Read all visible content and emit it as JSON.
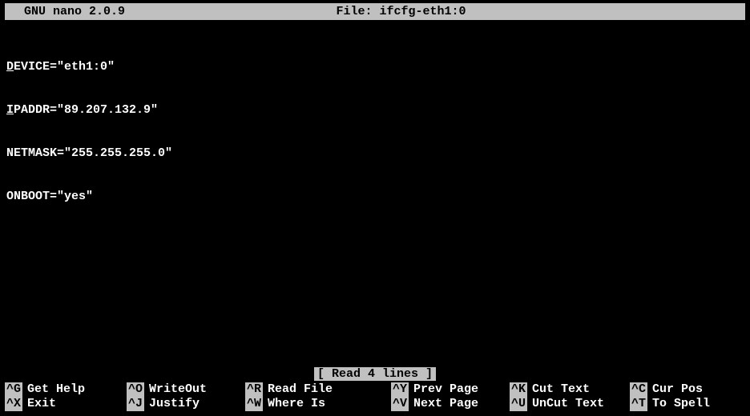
{
  "titlebar": {
    "app": "  GNU nano 2.0.9",
    "file": "File: ifcfg-eth1:0"
  },
  "content": {
    "lines": [
      "DEVICE=\"eth1:0\"",
      "IPADDR=\"89.207.132.9\"",
      "NETMASK=\"255.255.255.0\"",
      "ONBOOT=\"yes\""
    ]
  },
  "status": {
    "message": "[ Read 4 lines ]"
  },
  "shortcuts": {
    "row1": [
      {
        "key": "^G",
        "label": "Get Help"
      },
      {
        "key": "^O",
        "label": "WriteOut"
      },
      {
        "key": "^R",
        "label": "Read File"
      },
      {
        "key": "^Y",
        "label": "Prev Page"
      },
      {
        "key": "^K",
        "label": "Cut Text"
      },
      {
        "key": "^C",
        "label": "Cur Pos"
      }
    ],
    "row2": [
      {
        "key": "^X",
        "label": "Exit"
      },
      {
        "key": "^J",
        "label": "Justify"
      },
      {
        "key": "^W",
        "label": "Where Is"
      },
      {
        "key": "^V",
        "label": "Next Page"
      },
      {
        "key": "^U",
        "label": "UnCut Text"
      },
      {
        "key": "^T",
        "label": "To Spell"
      }
    ]
  }
}
